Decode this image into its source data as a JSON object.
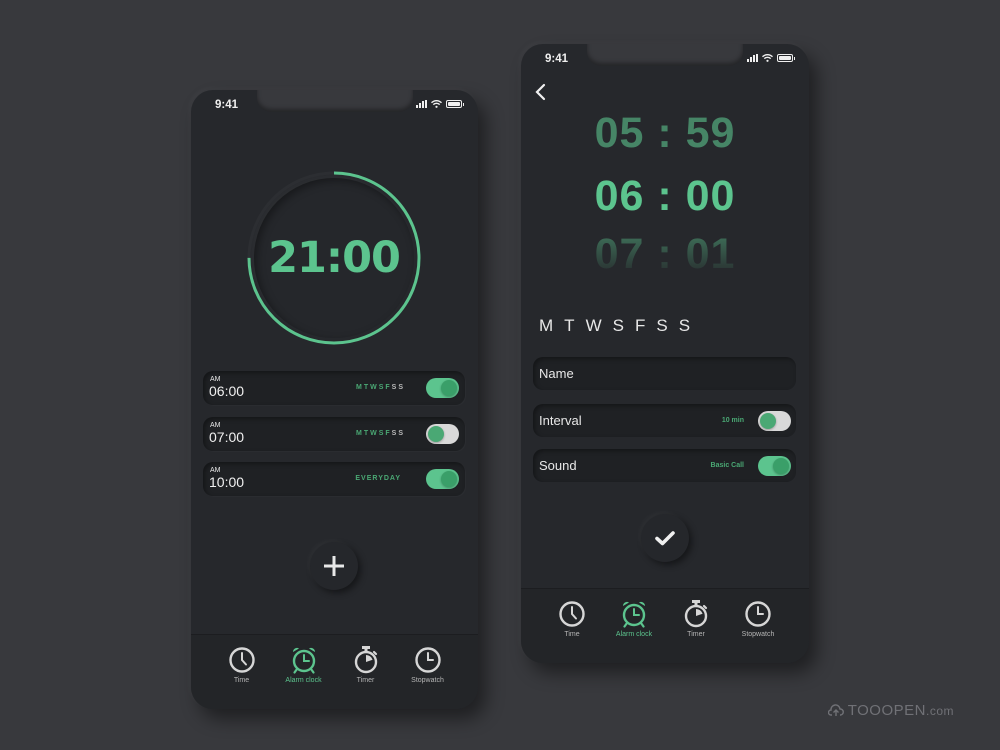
{
  "colors": {
    "background": "#38393d",
    "phone": "#26282c",
    "accent": "#5cc48e",
    "accent_dark": "#3a9f69",
    "muted_text": "#b5b5b5"
  },
  "left_screen": {
    "status_bar": {
      "time": "9:41"
    },
    "timer": {
      "display": "21:00",
      "progress_fraction": 0.75
    },
    "alarms": [
      {
        "ampm": "AM",
        "time": "06:00",
        "days": [
          {
            "letter": "M",
            "on": true
          },
          {
            "letter": "T",
            "on": true
          },
          {
            "letter": "W",
            "on": true
          },
          {
            "letter": "S",
            "on": true
          },
          {
            "letter": "F",
            "on": true
          },
          {
            "letter": "S",
            "on": false
          },
          {
            "letter": "S",
            "on": false
          }
        ],
        "label": "",
        "enabled": true
      },
      {
        "ampm": "AM",
        "time": "07:00",
        "days": [
          {
            "letter": "M",
            "on": true
          },
          {
            "letter": "T",
            "on": true
          },
          {
            "letter": "W",
            "on": true
          },
          {
            "letter": "S",
            "on": true
          },
          {
            "letter": "F",
            "on": true
          },
          {
            "letter": "S",
            "on": false
          },
          {
            "letter": "S",
            "on": false
          }
        ],
        "label": "",
        "enabled": false
      },
      {
        "ampm": "AM",
        "time": "10:00",
        "days": [],
        "label": "EVERYDAY",
        "enabled": true
      }
    ],
    "add_button": {
      "icon": "plus-icon"
    },
    "tabbar": {
      "tabs": [
        {
          "label": "Time",
          "icon": "clock-icon",
          "active": false
        },
        {
          "label": "Alarm clock",
          "icon": "alarm-clock-icon",
          "active": true
        },
        {
          "label": "Timer",
          "icon": "timer-icon",
          "active": false
        },
        {
          "label": "Stopwatch",
          "icon": "stopwatch-icon",
          "active": false
        }
      ]
    }
  },
  "right_screen": {
    "status_bar": {
      "time": "9:41"
    },
    "back_button": {
      "icon": "chevron-left-icon"
    },
    "time_picker": {
      "previous": "05 : 59",
      "selected": "06 : 00",
      "next": "07 : 01"
    },
    "weekdays": [
      "M",
      "T",
      "W",
      "S",
      "F",
      "S",
      "S"
    ],
    "fields": {
      "name": {
        "label": "Name"
      },
      "interval": {
        "label": "Interval",
        "value": "10 min",
        "enabled": false
      },
      "sound": {
        "label": "Sound",
        "value": "Basic Call",
        "enabled": true
      }
    },
    "confirm_button": {
      "icon": "checkmark-icon"
    },
    "tabbar": {
      "tabs": [
        {
          "label": "Time",
          "icon": "clock-icon",
          "active": false
        },
        {
          "label": "Alarm clock",
          "icon": "alarm-clock-icon",
          "active": true
        },
        {
          "label": "Timer",
          "icon": "timer-icon",
          "active": false
        },
        {
          "label": "Stopwatch",
          "icon": "stopwatch-icon",
          "active": false
        }
      ]
    }
  },
  "watermark": {
    "brand": "TOOOPEN",
    "suffix": ".com"
  }
}
